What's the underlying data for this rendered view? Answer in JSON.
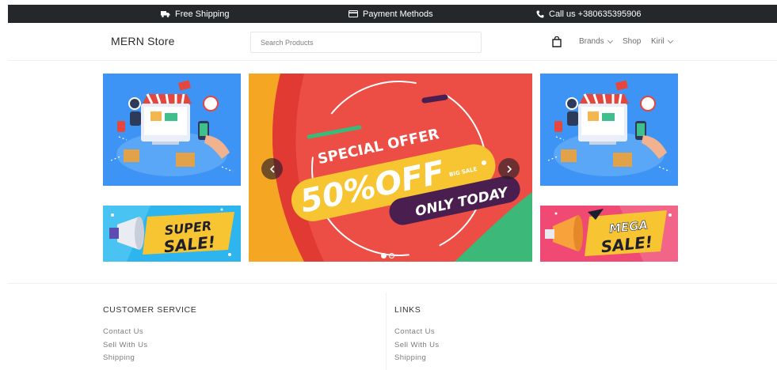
{
  "topbar": {
    "items": [
      {
        "icon": "truck-icon",
        "label": "Free Shipping"
      },
      {
        "icon": "credit-card-icon",
        "label": "Payment Methods"
      },
      {
        "icon": "phone-icon",
        "label": "Call us +380635395906"
      }
    ]
  },
  "header": {
    "logo": "MERN Store",
    "search": {
      "placeholder": "Search Products",
      "value": ""
    },
    "cart_icon": "shopping-bag-icon",
    "nav": {
      "brands": "Brands",
      "shop": "Shop",
      "user": "Kiril"
    }
  },
  "banners": {
    "left_top": {
      "image": "shopping-illustration"
    },
    "left_bottom": {
      "image": "super-sale-megaphone",
      "text": "SUPER SALE!"
    },
    "right_top": {
      "image": "shopping-illustration"
    },
    "right_bottom": {
      "image": "mega-sale-megaphone",
      "text": "MEGA SALE!"
    }
  },
  "carousel": {
    "special_offer": "SPECIAL OFFER",
    "discount": "50%OFF",
    "big_sale": "BIG SALE",
    "only_today": "ONLY TODAY",
    "slides_count": 2,
    "active_slide": 1
  },
  "colors": {
    "topbar_bg": "#25282b",
    "banner_blue": "#3d94f4",
    "carousel_red": "#ec4d45",
    "sale_yellow": "#f7c531",
    "mega_pink": "#f04a74"
  },
  "footer": {
    "columns": [
      {
        "title": "CUSTOMER SERVICE",
        "links": [
          "Contact Us",
          "Sell With Us",
          "Shipping"
        ]
      },
      {
        "title": "LINKS",
        "links": [
          "Contact Us",
          "Sell With Us",
          "Shipping"
        ]
      }
    ]
  }
}
